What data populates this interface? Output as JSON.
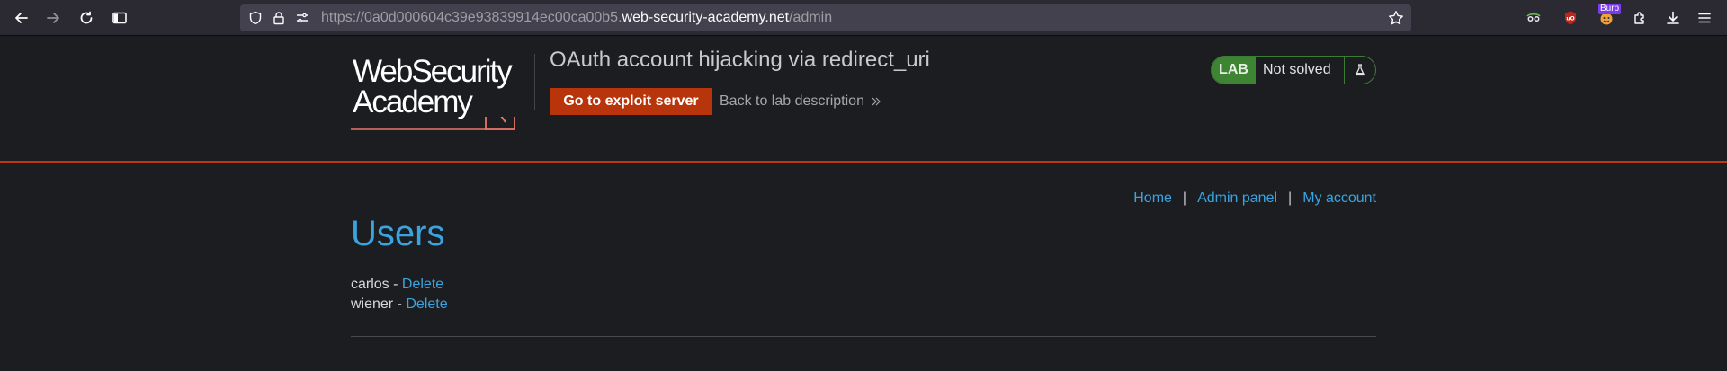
{
  "browser": {
    "url_prefix": "https://0a0d000604c39e93839914ec00ca00b5.",
    "url_domain": "web-security-academy.net",
    "url_path": "/admin",
    "burp_badge": "Burp"
  },
  "logo": {
    "line1": "WebSecurity",
    "line2": "Academy"
  },
  "lab": {
    "title": "OAuth account hijacking via redirect_uri",
    "exploit_button": "Go to exploit server",
    "back_link": "Back to lab description",
    "status_label": "LAB",
    "status_text": "Not solved",
    "accent_color": "#c0370e",
    "status_color": "#3e8533"
  },
  "nav": {
    "home": "Home",
    "admin_panel": "Admin panel",
    "my_account": "My account",
    "separator": "|"
  },
  "page": {
    "title": "Users",
    "users": [
      {
        "name": "carlos",
        "separator": " - ",
        "action": "Delete"
      },
      {
        "name": "wiener",
        "separator": " - ",
        "action": "Delete"
      }
    ]
  }
}
